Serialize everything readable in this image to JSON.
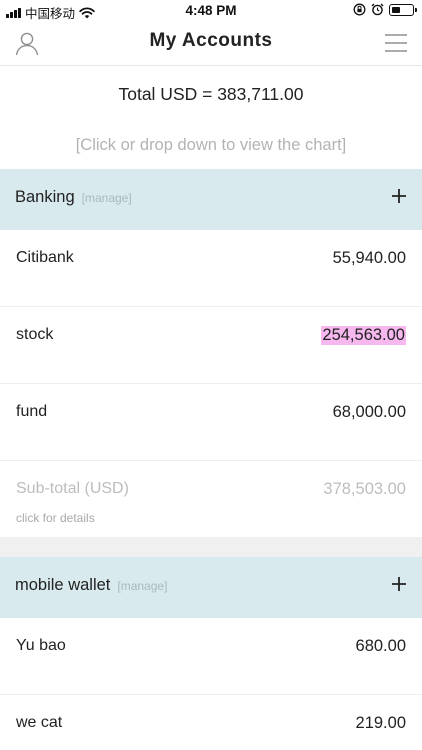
{
  "status_bar": {
    "carrier": "中国移动",
    "time": "4:48 PM"
  },
  "nav": {
    "title": "My Accounts",
    "left_icon": "user-icon",
    "right_icon": "menu-icon"
  },
  "summary": {
    "total_text": "Total USD = 383,711.00",
    "chart_hint": "[Click or drop down to view the chart]"
  },
  "sections": [
    {
      "name": "Banking",
      "manage_label": "[manage]",
      "rows": [
        {
          "label": "Citibank",
          "value": "55,940.00"
        },
        {
          "label": "stock",
          "value": "254,563.00"
        },
        {
          "label": "fund",
          "value": "68,000.00"
        }
      ],
      "subtotal": {
        "label": "Sub-total (USD)",
        "value": "378,503.00",
        "hint": "click for details"
      }
    },
    {
      "name": "mobile wallet",
      "manage_label": "[manage]",
      "rows": [
        {
          "label": "Yu bao",
          "value": "680.00"
        },
        {
          "label": "we cat",
          "value": "219.00"
        }
      ]
    }
  ],
  "colors": {
    "section_header_bg": "#d8eaee",
    "highlight": "#f6b8ee",
    "muted_text": "#bdbdbd"
  }
}
